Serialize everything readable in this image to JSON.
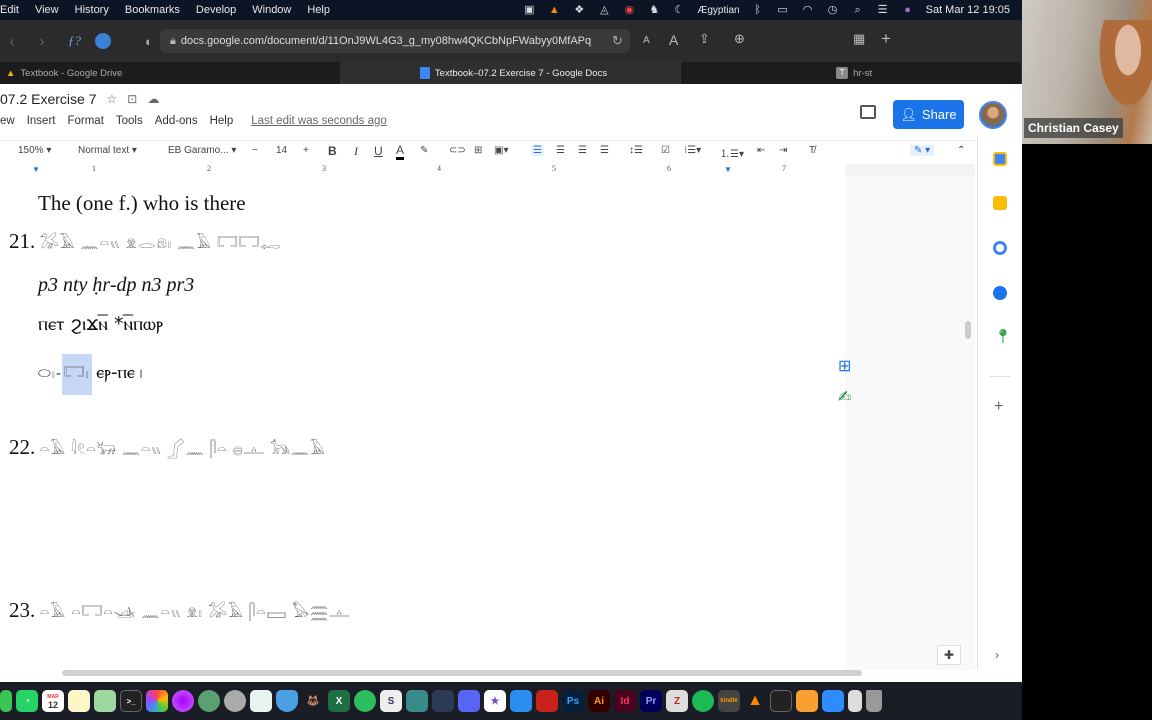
{
  "menubar": {
    "items": [
      "Edit",
      "View",
      "History",
      "Bookmarks",
      "Develop",
      "Window",
      "Help"
    ],
    "input_source": "Ægyptian",
    "datetime": "Sat Mar 12  19:05"
  },
  "browser": {
    "url": "docs.google.com/document/d/11OnJ9WL4G3_g_my08hw4QKCbNpFWabyy0MfAPq",
    "font_small": "A",
    "font_large": "A",
    "tabs": [
      {
        "label": "Textbook - Google Drive"
      },
      {
        "label": "Textbook–07.2 Exercise 7 - Google Docs"
      },
      {
        "label": "hr-st",
        "badge": "T"
      }
    ]
  },
  "doc": {
    "title": "07.2 Exercise 7",
    "menu": [
      "ew",
      "Insert",
      "Format",
      "Tools",
      "Add-ons",
      "Help"
    ],
    "last_edit": "Last edit was seconds ago",
    "share_label": "Share",
    "toolbar": {
      "zoom": "150%",
      "style": "Normal text",
      "font": "EB Garamo...",
      "font_size": "14",
      "bold": "B",
      "italic": "I",
      "underline": "U",
      "text_color": "A"
    },
    "ruler_numbers": [
      "1",
      "2",
      "3",
      "4",
      "5",
      "6",
      "7"
    ],
    "content": {
      "line_prev": "The (one f.) who is there",
      "ex21_num": "21.",
      "ex21_glyphs": "𓅮𓄿 𓈖𓏏𓏭 𓁷𓂋𓁶𓏤 𓈖𓄿 𓉐𓉐𓉻",
      "translit": "p3 nty ḥr-dp n3 pr3",
      "coptic": "ⲡⲉⲧ ϩⲓϫⲛ̅ *ⲛ̅ⲡⲱⲣ",
      "line4_glyphs": "⬭𓏤-",
      "line4_selected": "𓉐𓏤",
      "line4_coptic": "ⲉⲣ-ⲡⲉ",
      "ex22_num": "22.",
      "ex22_glyphs": "𓏏𓄿 𓇋𓏲𓏏𓃒 𓈖𓏏𓏭 𓂾𓈖 𓋴𓏏 𓐍𓊵 𓃥𓈖𓄿",
      "ex23_num": "23.",
      "ex23_glyphs": "𓏏𓄿 𓏏𓉐𓏏𓊛 𓈖𓏏𓏭 𓁷𓏤 𓅮𓄿 𓋴𓏏𓈙 𓅃𓈗𓊵"
    }
  },
  "video": {
    "name": "Christian Casey"
  },
  "dock": {
    "calendar_month": "MAR",
    "calendar_day": "12",
    "apps": [
      "Messages",
      "WhatsApp",
      "Calendar",
      "Notes",
      "Maps",
      "Terminal",
      "Photos",
      "Flower",
      "Atom",
      "Pro",
      "Keyboard",
      "Shield",
      "Fox",
      "Excel",
      "Evernote",
      "Scrivener",
      "Stacks",
      "Kindle Reader",
      "Discord",
      "iMovie",
      "Keynote",
      "Acrobat",
      "Ps",
      "Ai",
      "Id",
      "Pr",
      "Zotero",
      "Spotify",
      "kindle",
      "VLC",
      "Activity Monitor",
      "Pages",
      "Zoom",
      "Preview",
      "Trash"
    ]
  }
}
